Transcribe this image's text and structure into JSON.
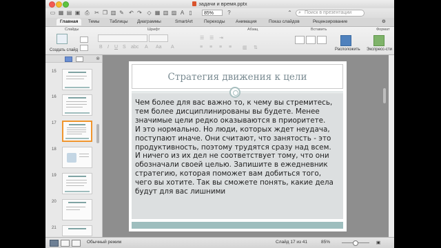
{
  "window": {
    "doc_title": "задачи и время.pptx",
    "zoom": "85%",
    "search_placeholder": "Поиск в презентации"
  },
  "ribbon": {
    "tabs": [
      "Главная",
      "Темы",
      "Таблицы",
      "Диаграммы",
      "SmartArt",
      "Переходы",
      "Анимация",
      "Показ слайдов",
      "Рецензирование"
    ],
    "active_tab": "Главная",
    "groups": [
      "Слайды",
      "Шрифт",
      "Абзац",
      "Вставить",
      "Формат"
    ],
    "new_slide": "Создать слайд",
    "arrange": "Расположить",
    "quick_styles": "Экспресс-сти"
  },
  "slides_pane": {
    "numbers": [
      "15",
      "16",
      "17",
      "18",
      "19",
      "20",
      "21"
    ],
    "selected": "17"
  },
  "slide": {
    "title": "Стратегия движения к цели",
    "body_lines": [
      "Чем более для вас важно то, к чему вы стремитесь,",
      "тем более дисциплинированы вы будете. Менее",
      "значимые цели редко оказываются в приоритете.",
      "И это нормально. Но люди, которых ждет неудача,",
      "поступают иначе. Они считают, что занятость - это",
      "продуктивность, поэтому трудятся сразу над всем.",
      "И ничего из их дел не соответствует тому, что они",
      "обозначали своей целью. Запишите в ежедневник",
      "стратегию, которая поможет вам добиться того,",
      "чего вы хотите. Так вы сможете понять, какие дела",
      "будут для вас лишними"
    ]
  },
  "status": {
    "view_mode": "Обычный режим",
    "slide_counter": "Слайд 17 из 41",
    "zoom": "85%"
  }
}
